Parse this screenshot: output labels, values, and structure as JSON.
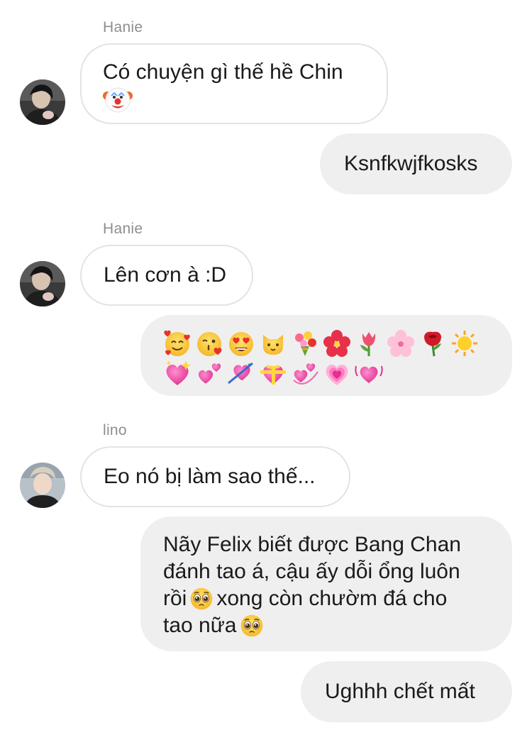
{
  "conversation": {
    "messages": [
      {
        "sender": "Hanie",
        "direction": "in",
        "text": "Có chuyện gì thế hề Chin",
        "emoji": [
          "clown-face"
        ]
      },
      {
        "direction": "out",
        "text": "Ksnfkwjfkosks"
      },
      {
        "sender": "Hanie",
        "direction": "in",
        "text": "Lên cơn à :D"
      },
      {
        "direction": "out",
        "emoji": [
          "smiling-face-with-hearts",
          "face-blowing-kiss",
          "heart-eyes",
          "cat-face",
          "bouquet",
          "hibiscus",
          "tulip",
          "cherry-blossom",
          "rose",
          "sun",
          "sparkling-heart",
          "two-hearts",
          "heart-with-arrow",
          "heart-with-ribbon",
          "revolving-hearts",
          "growing-heart",
          "beating-heart"
        ]
      },
      {
        "sender": "lino",
        "direction": "in",
        "text": "Eo nó bị làm sao thế..."
      },
      {
        "direction": "out",
        "lines": [
          "Nãy Felix biết được Bang Chan",
          "đánh tao á, cậu ấy dỗi ổng luôn",
          "rồi",
          "xong còn chườm đá cho",
          "tao nữa"
        ],
        "emoji": [
          "pleading-face",
          "pleading-face"
        ]
      },
      {
        "direction": "out",
        "text": "Ughhh chết mất"
      }
    ]
  },
  "colors": {
    "incoming_border": "#e3e3e3",
    "outgoing_bg": "#efefef",
    "sender_name": "#8e8e8e"
  }
}
